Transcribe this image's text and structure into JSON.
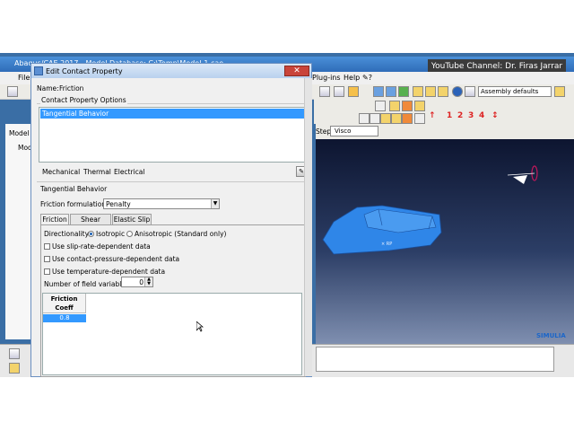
{
  "main_window": {
    "title": "Abaqus/CAE 2017 - Model Database: C:\\Temp\\Model-1.cae",
    "menu": [
      "File",
      "Plug-ins",
      "Help",
      "✎?"
    ],
    "assembly_combo": "Assembly defaults",
    "step_label": "Step:",
    "step_value": "Visco",
    "model_tab": "Model",
    "tree_item": "Mod",
    "brand": "SIMULIA",
    "toolbar_numbers": [
      "1",
      "2",
      "3",
      "4"
    ],
    "rp_label": "RP",
    "colors": {
      "brand_blue": "#3399ff",
      "part_blue": "#2f86e8",
      "viewport_top": "#0d1530"
    }
  },
  "overlay": {
    "youtube": "YouTube Channel: Dr. Firas Jarrar"
  },
  "dialog": {
    "title": "Edit Contact Property",
    "close_label": "✕",
    "name_label": "Name:",
    "name_value": "Friction",
    "options_header": "Contact Property Options",
    "options": [
      "Tangential Behavior"
    ],
    "menus": [
      "Mechanical",
      "Thermal",
      "Electrical"
    ],
    "section_title": "Tangential Behavior",
    "friction_formulation_label": "Friction formulation:",
    "friction_formulation_value": "Penalty",
    "tabs": [
      "Friction",
      "Shear Stress",
      "Elastic Slip"
    ],
    "directionality_label": "Directionality:",
    "directionality_options": [
      "Isotropic",
      "Anisotropic (Standard only)"
    ],
    "checkboxes": [
      "Use slip-rate-dependent data",
      "Use contact-pressure-dependent data",
      "Use temperature-dependent data"
    ],
    "field_vars_label": "Number of field variables:",
    "field_vars_value": "0",
    "table_header_line1": "Friction",
    "table_header_line2": "Coeff",
    "table_value": "0.8"
  }
}
